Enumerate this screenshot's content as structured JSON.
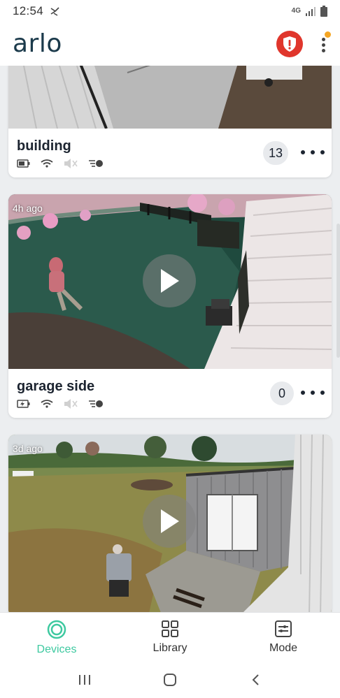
{
  "status_bar": {
    "time": "12:54",
    "network": "4G"
  },
  "header": {
    "logo": "arlo"
  },
  "cameras": [
    {
      "name": "building",
      "count": "13",
      "time_ago": ""
    },
    {
      "name": "garage side",
      "count": "0",
      "time_ago": "4h ago"
    },
    {
      "name": "",
      "count": "",
      "time_ago": "3d ago"
    }
  ],
  "bottom_nav": {
    "tabs": [
      {
        "label": "Devices",
        "icon": "devices-icon",
        "active": true
      },
      {
        "label": "Library",
        "icon": "library-icon",
        "active": false
      },
      {
        "label": "Mode",
        "icon": "mode-icon",
        "active": false
      }
    ]
  },
  "colors": {
    "accent": "#3ec9a0",
    "alert": "#e0362c",
    "brand": "#1b3a4b",
    "notification": "#f5a623"
  }
}
